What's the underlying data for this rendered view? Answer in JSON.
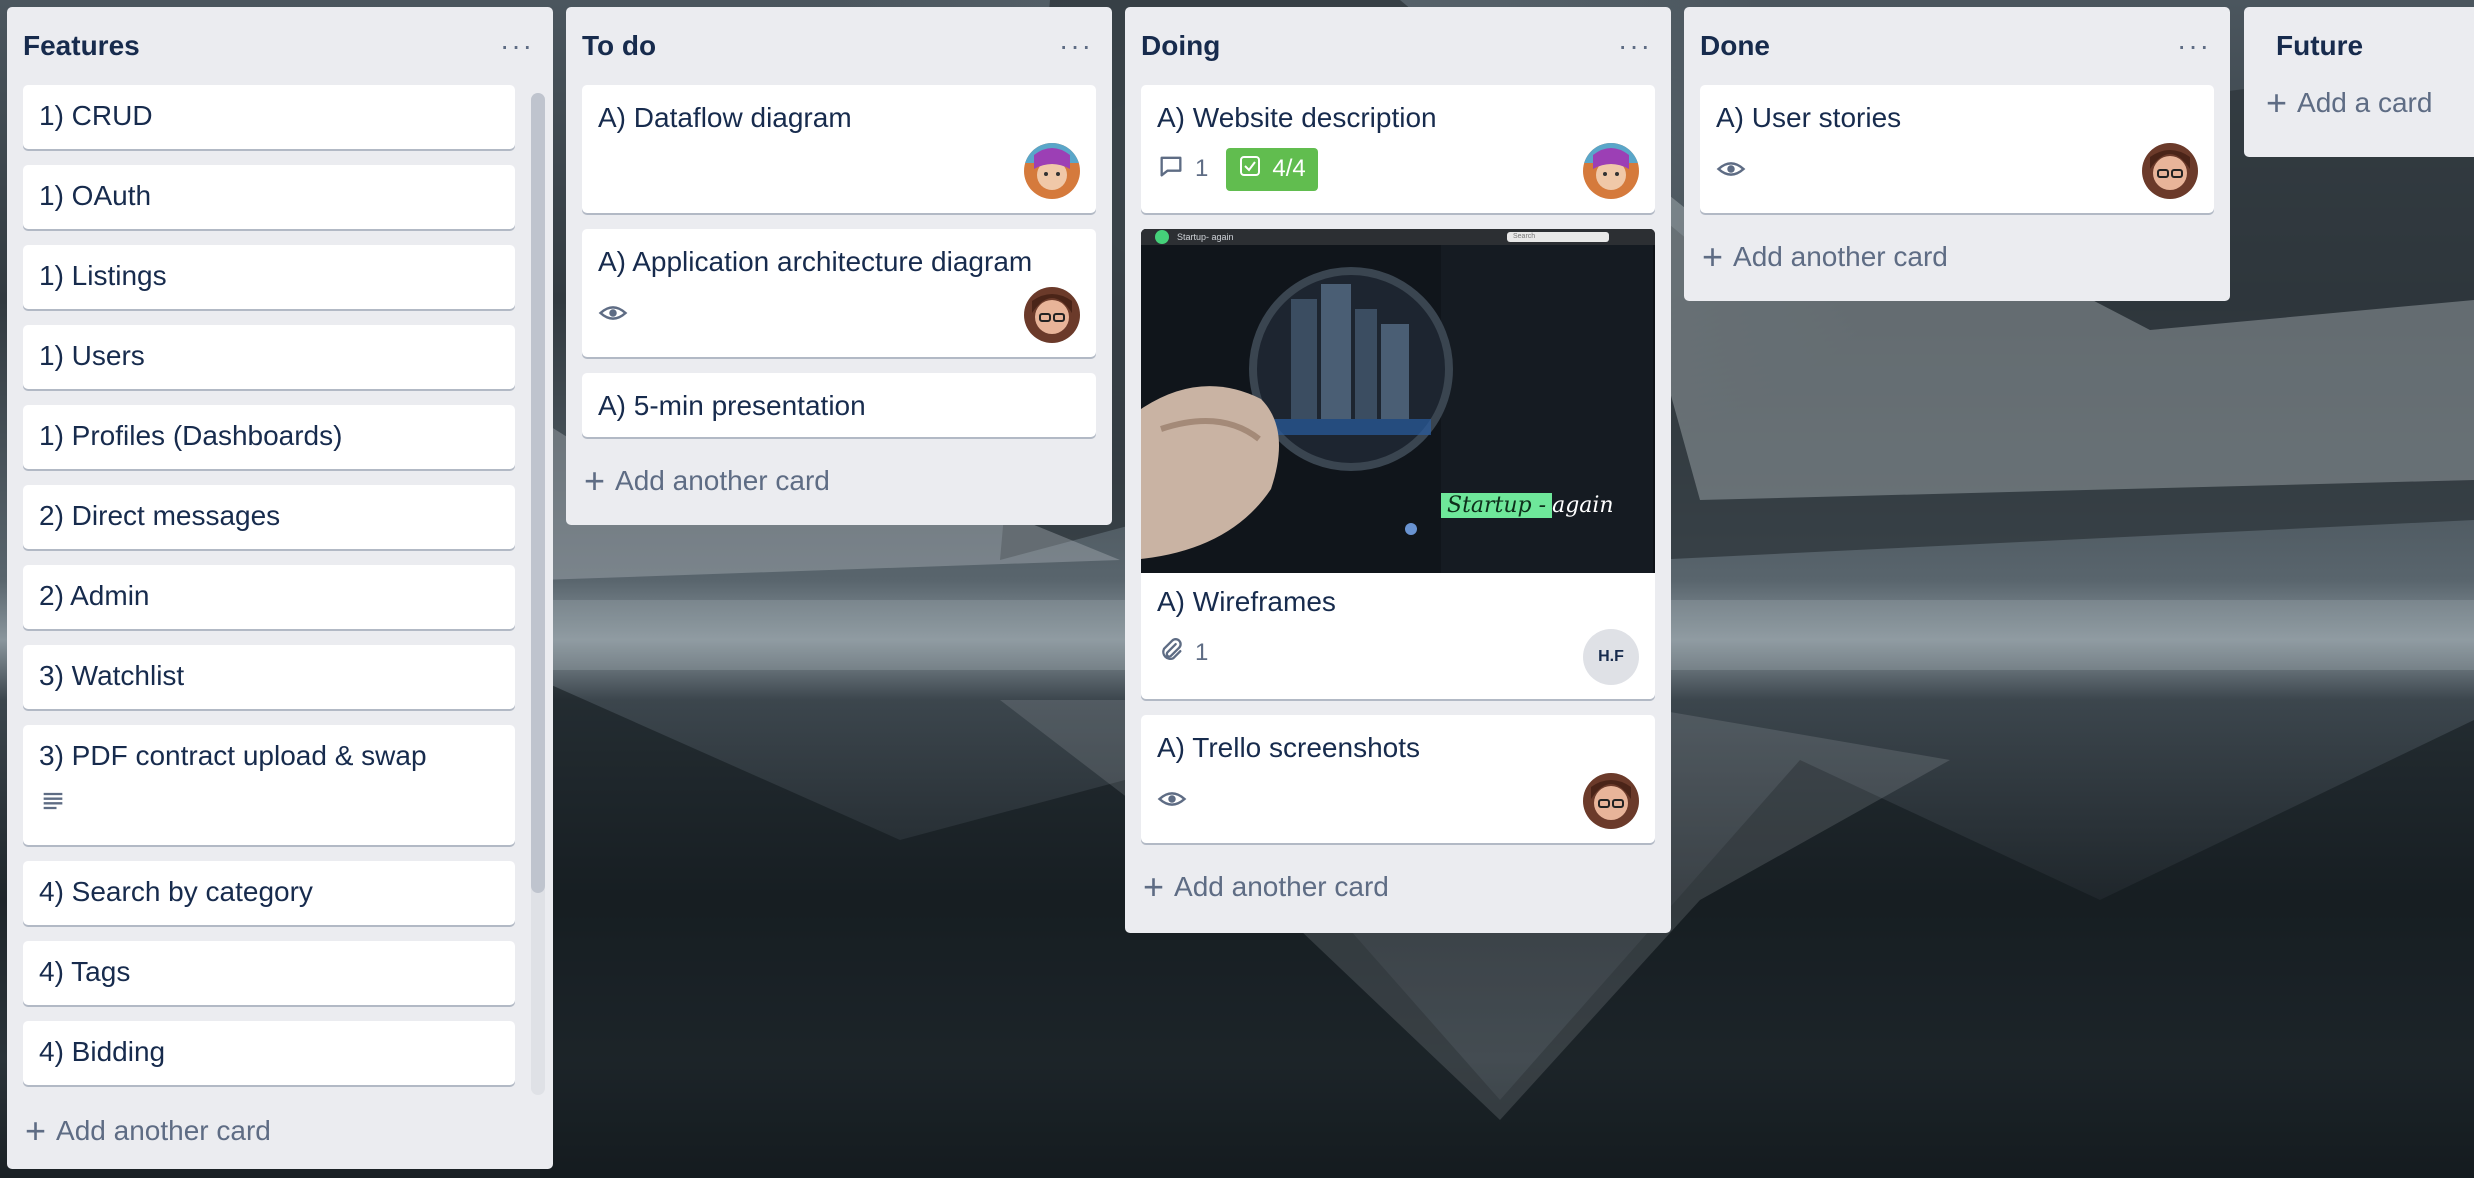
{
  "board": {
    "lists": [
      {
        "title": "Features",
        "menu": "···",
        "add_label": "Add another card",
        "cards": [
          {
            "title": "1) CRUD"
          },
          {
            "title": "1) OAuth"
          },
          {
            "title": "1) Listings"
          },
          {
            "title": "1) Users"
          },
          {
            "title": "1) Profiles (Dashboards)"
          },
          {
            "title": "2) Direct messages"
          },
          {
            "title": "2) Admin"
          },
          {
            "title": "3) Watchlist"
          },
          {
            "title": "3) PDF contract upload & swap"
          },
          {
            "title": "4) Search by category"
          },
          {
            "title": "4) Tags"
          },
          {
            "title": "4) Bidding"
          }
        ]
      },
      {
        "title": "To do",
        "menu": "···",
        "add_label": "Add another card",
        "cards": [
          {
            "title": "A) Dataflow diagram"
          },
          {
            "title": "A) Application architecture diagram"
          },
          {
            "title": "A) 5-min presentation"
          }
        ]
      },
      {
        "title": "Doing",
        "menu": "···",
        "add_label": "Add another card",
        "cards": [
          {
            "title": "A) Website description",
            "comments": "1",
            "checklist": "4/4"
          },
          {
            "title": "A) Wireframes",
            "attachments": "1",
            "member_initials": "H.F",
            "cover": {
              "brand": "Startup- again",
              "search": "Search",
              "caption_highlight": "Startup -",
              "caption_rest": "again"
            }
          },
          {
            "title": "A) Trello screenshots"
          }
        ]
      },
      {
        "title": "Done",
        "menu": "···",
        "add_label": "Add another card",
        "cards": [
          {
            "title": "A) User stories"
          }
        ]
      },
      {
        "title": "Future",
        "add_label": "Add a card"
      }
    ]
  },
  "colors": {
    "list_bg": "#ebecf0",
    "card_bg": "#ffffff",
    "text": "#172b4d",
    "muted": "#5e6c84",
    "checklist_complete": "#61bd4f"
  }
}
